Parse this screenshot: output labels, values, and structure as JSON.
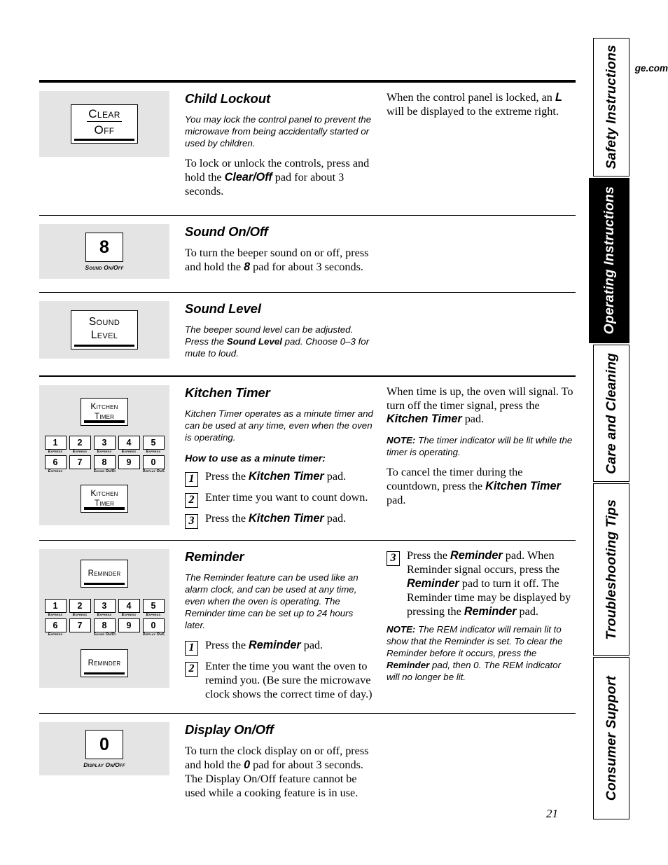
{
  "header": {
    "site_url": "ge.com"
  },
  "page_number": "21",
  "side_tabs": [
    {
      "label": "Safety Instructions",
      "active": false
    },
    {
      "label": "Operating Instructions",
      "active": true
    },
    {
      "label": "Care and Cleaning",
      "active": false
    },
    {
      "label": "Troubleshooting Tips",
      "active": false
    },
    {
      "label": "Consumer Support",
      "active": false
    }
  ],
  "keypad": {
    "row1": [
      {
        "digit": "1",
        "caption": "Express"
      },
      {
        "digit": "2",
        "caption": "Express"
      },
      {
        "digit": "3",
        "caption": "Express"
      },
      {
        "digit": "4",
        "caption": "Express"
      },
      {
        "digit": "5",
        "caption": "Express"
      }
    ],
    "row2": [
      {
        "digit": "6",
        "caption": "Express"
      },
      {
        "digit": "7",
        "caption": ""
      },
      {
        "digit": "8",
        "caption": "Sound On/Off"
      },
      {
        "digit": "9",
        "caption": ""
      },
      {
        "digit": "0",
        "caption": "Display On/Off"
      }
    ]
  },
  "sections": [
    {
      "id": "child-lockout",
      "title": "Child Lockout",
      "button": {
        "type": "clear-off",
        "line1": "Clear",
        "line2": "Off"
      },
      "mid_paragraphs": [
        {
          "style": "sans",
          "parts": [
            {
              "t": "You may lock the control panel to prevent the microwave from being accidentally started or used by children."
            }
          ]
        },
        {
          "style": "serif",
          "parts": [
            {
              "t": "To lock or unlock the controls, press and hold the "
            },
            {
              "t": "Clear/Off",
              "b": true
            },
            {
              "t": " pad for about 3 seconds."
            }
          ]
        }
      ],
      "right_paragraphs": [
        {
          "style": "serif",
          "parts": [
            {
              "t": "When the control panel is locked, an "
            },
            {
              "t": "L",
              "b": true
            },
            {
              "t": " will be displayed to the extreme right."
            }
          ]
        }
      ]
    },
    {
      "id": "sound-on-off",
      "title": "Sound On/Off",
      "button": {
        "type": "digit-pad",
        "digit": "8",
        "caption": "Sound On/Off"
      },
      "mid_paragraphs": [
        {
          "style": "serif",
          "parts": [
            {
              "t": "To turn the beeper sound on or off, press and hold the "
            },
            {
              "t": "8",
              "b": true
            },
            {
              "t": " pad for about 3 seconds."
            }
          ]
        }
      ],
      "right_paragraphs": []
    },
    {
      "id": "sound-level",
      "title": "Sound Level",
      "button": {
        "type": "two-line",
        "line1": "Sound",
        "line2": "Level"
      },
      "mid_paragraphs": [
        {
          "style": "sans",
          "parts": [
            {
              "t": "The beeper sound level can be adjusted. Press the "
            },
            {
              "t": "Sound Level",
              "b": true
            },
            {
              "t": " pad. Choose 0–3 for mute to loud."
            }
          ]
        }
      ],
      "right_paragraphs": []
    },
    {
      "id": "kitchen-timer",
      "title": "Kitchen Timer",
      "button": {
        "type": "keypad-stack",
        "top_label_1": "Kitchen",
        "top_label_2": "Timer",
        "bottom_label_1": "Kitchen",
        "bottom_label_2": "Timer"
      },
      "mid_paragraphs": [
        {
          "style": "sans",
          "parts": [
            {
              "t": "Kitchen Timer operates as a minute timer and can be used at any time, even when the oven is operating."
            }
          ]
        }
      ],
      "mid_subhead": "How to use as a minute timer:",
      "mid_steps": [
        {
          "num": "1",
          "parts": [
            {
              "t": "Press the "
            },
            {
              "t": "Kitchen Timer",
              "b": true
            },
            {
              "t": " pad."
            }
          ]
        },
        {
          "num": "2",
          "parts": [
            {
              "t": "Enter time you want to count down."
            }
          ]
        },
        {
          "num": "3",
          "parts": [
            {
              "t": "Press the "
            },
            {
              "t": "Kitchen Timer",
              "b": true
            },
            {
              "t": " pad."
            }
          ]
        }
      ],
      "right_paragraphs": [
        {
          "style": "serif",
          "parts": [
            {
              "t": "When time is up, the oven will signal. To turn off the timer signal, press the "
            },
            {
              "t": "Kitchen Timer",
              "b": true
            },
            {
              "t": " pad."
            }
          ]
        },
        {
          "style": "sans",
          "parts": [
            {
              "t": "NOTE:",
              "b": true
            },
            {
              "t": " The timer indicator will be lit while the timer is operating."
            }
          ]
        },
        {
          "style": "serif",
          "parts": [
            {
              "t": "To cancel the timer during the countdown, press the "
            },
            {
              "t": "Kitchen Timer",
              "b": true
            },
            {
              "t": " pad."
            }
          ]
        }
      ]
    },
    {
      "id": "reminder",
      "title": "Reminder",
      "button": {
        "type": "keypad-stack-rem",
        "top_label": "Reminder",
        "bottom_label": "Reminder"
      },
      "mid_paragraphs": [
        {
          "style": "sans",
          "parts": [
            {
              "t": "The Reminder feature can be used like an alarm clock, and can be used at any time, even when the oven is operating. The Reminder time can be set up to 24 hours later."
            }
          ]
        }
      ],
      "mid_steps": [
        {
          "num": "1",
          "parts": [
            {
              "t": "Press the "
            },
            {
              "t": "Reminder",
              "b": true
            },
            {
              "t": " pad."
            }
          ]
        },
        {
          "num": "2",
          "parts": [
            {
              "t": "Enter the time you want the oven to remind you. (Be sure the microwave clock shows the correct time of day.)"
            }
          ]
        }
      ],
      "right_steps": [
        {
          "num": "3",
          "parts": [
            {
              "t": "Press the "
            },
            {
              "t": "Reminder",
              "b": true
            },
            {
              "t": " pad.  When Reminder signal occurs, press the "
            },
            {
              "t": "Reminder",
              "b": true
            },
            {
              "t": " pad to turn it off. The Reminder time may be displayed by pressing the "
            },
            {
              "t": "Reminder",
              "b": true
            },
            {
              "t": " pad."
            }
          ]
        }
      ],
      "right_paragraphs": [
        {
          "style": "sans",
          "parts": [
            {
              "t": "NOTE:",
              "b": true
            },
            {
              "t": " The REM indicator will remain lit to show that the Reminder is set. To clear the Reminder before it occurs, press the "
            },
            {
              "t": "Reminder",
              "b": true
            },
            {
              "t": " pad, then 0. The REM indicator will no longer be lit."
            }
          ]
        }
      ]
    },
    {
      "id": "display-on-off",
      "title": "Display On/Off",
      "button": {
        "type": "digit-pad",
        "digit": "0",
        "caption": "Display On/Off"
      },
      "mid_paragraphs": [
        {
          "style": "serif",
          "parts": [
            {
              "t": "To turn the clock display on or off, press and hold the "
            },
            {
              "t": "0",
              "b": true
            },
            {
              "t": " pad for about 3 seconds. The Display On/Off feature cannot be used while a cooking feature is in use."
            }
          ]
        }
      ],
      "right_paragraphs": []
    }
  ]
}
